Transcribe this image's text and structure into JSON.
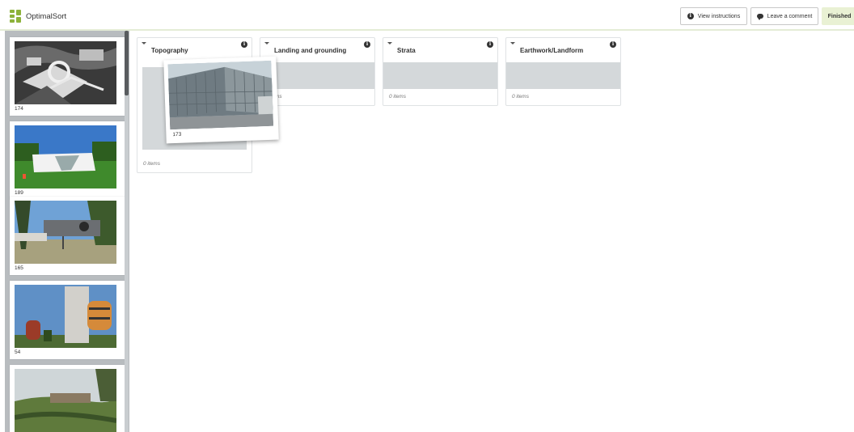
{
  "app": {
    "name": "OptimalSort"
  },
  "header": {
    "view_instructions": "View instructions",
    "leave_comment": "Leave a comment",
    "finished": "Finished"
  },
  "sidebar": {
    "cards": [
      {
        "id": "174"
      },
      {
        "id": "189"
      },
      {
        "id": "165"
      },
      {
        "id": "54"
      },
      {
        "id": ""
      }
    ]
  },
  "categories": [
    {
      "title": "Topography",
      "count": "0 items"
    },
    {
      "title": "Landing and grounding",
      "count": "ms"
    },
    {
      "title": "Strata",
      "count": "0 items"
    },
    {
      "title": "Earthwork/Landform",
      "count": "0 items"
    }
  ],
  "dragging": {
    "id": "173"
  },
  "colors": {
    "accent": "#8db23b",
    "finished_bg": "#e9f1d4",
    "sidebar_bg": "#b8bcbf",
    "dropzone": "#d4d8da"
  }
}
